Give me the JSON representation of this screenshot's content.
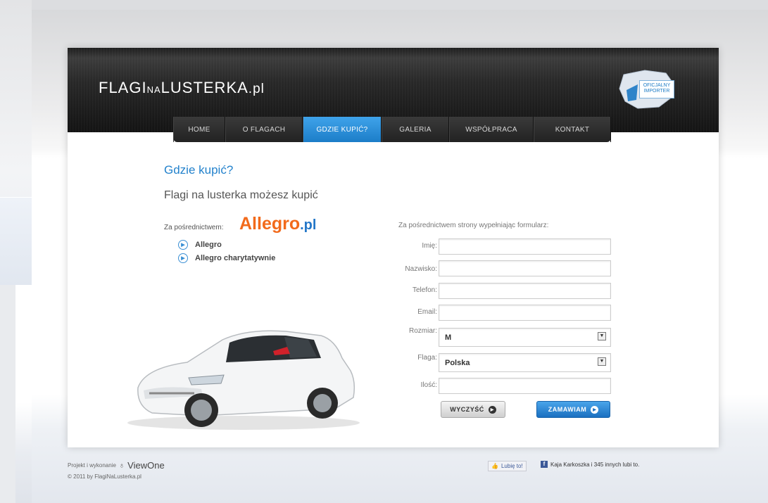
{
  "logo": {
    "part1": "FLAGI",
    "part2": "NA",
    "part3": "LUSTERKA",
    "part4": ".pl"
  },
  "badge": {
    "line1": "OFICJALNY",
    "line2": "IMPORTER"
  },
  "nav": {
    "items": [
      {
        "label": "HOME",
        "active": false
      },
      {
        "label": "O FLAGACH",
        "active": false
      },
      {
        "label": "GDZIE KUPIĆ?",
        "active": true
      },
      {
        "label": "GALERIA",
        "active": false
      },
      {
        "label": "WSPÓŁPRACA",
        "active": false
      },
      {
        "label": "KONTAKT",
        "active": false
      }
    ]
  },
  "main": {
    "title": "Gdzie kupić?",
    "subtitle": "Flagi na lusterka możesz kupić",
    "allegro": {
      "intro": "Za pośrednictwem:",
      "brand": "Allegro",
      "brand_suffix": ".pl"
    },
    "links": [
      "Allegro",
      "Allegro charytatywnie"
    ]
  },
  "form": {
    "intro": "Za pośrednictwem strony wypełniając formularz:",
    "fields": [
      {
        "label": "Imię:",
        "value": ""
      },
      {
        "label": "Nazwisko:",
        "value": ""
      },
      {
        "label": "Telefon:",
        "value": ""
      },
      {
        "label": "Email:",
        "value": ""
      },
      {
        "label": "Rozmiar:",
        "value": "M"
      },
      {
        "label": "Flaga:",
        "value": "Polska"
      },
      {
        "label": "Ilość:",
        "value": ""
      }
    ],
    "clear_label": "WYCZYŚĆ",
    "order_label": "ZAMAWIAM"
  },
  "footer": {
    "credit": "Projekt i wykonanie",
    "agency": "ViewOne",
    "copyright": "© 2011 by FlagiNaLusterka.pl",
    "like_label": "Lubię to!",
    "likes_text": "Kaja Karkoszka i 345 innych lubi to."
  }
}
